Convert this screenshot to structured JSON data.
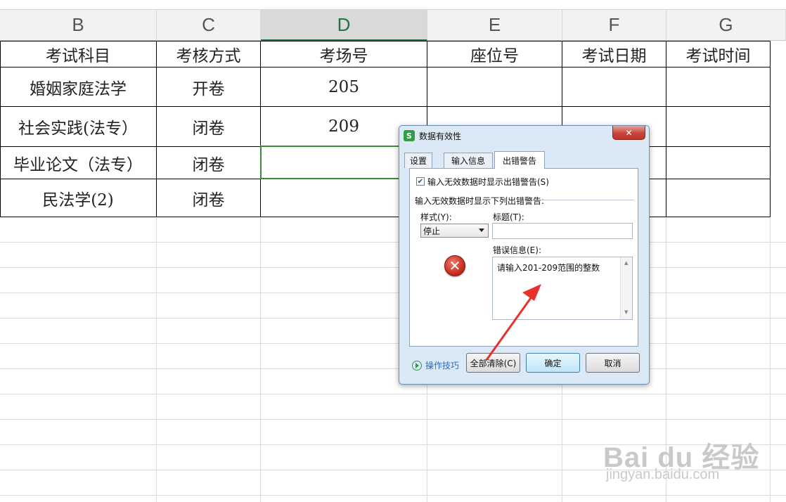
{
  "spreadsheet": {
    "columns": [
      "B",
      "C",
      "D",
      "E",
      "F",
      "G"
    ],
    "active_column": "D",
    "header_row": [
      "考试科目",
      "考核方式",
      "考场号",
      "座位号",
      "考试日期",
      "考试时间"
    ],
    "rows": [
      [
        "婚姻家庭法学",
        "开卷",
        "205",
        "",
        "",
        ""
      ],
      [
        "社会实践(法专）",
        "闭卷",
        "209",
        "",
        "",
        ""
      ],
      [
        "毕业论文（法专）",
        "闭卷",
        "",
        "",
        "",
        ""
      ],
      [
        "民法学(2)",
        "闭卷",
        "",
        "",
        "",
        ""
      ]
    ]
  },
  "dialog": {
    "title": "数据有效性",
    "close_label": "✕",
    "tabs": [
      "设置",
      "输入信息",
      "出错警告"
    ],
    "active_tab": "出错警告",
    "show_error_checkbox": {
      "checked": true,
      "label": "输入无效数据时显示出错警告(S)"
    },
    "section_label": "输入无效数据时显示下列出错警告:",
    "style_label": "样式(Y):",
    "style_value": "停止",
    "title_label": "标题(T):",
    "title_value": "",
    "error_message_label": "错误信息(E):",
    "error_message_value": "请输入201-209范围的整数",
    "tips_label": "操作技巧",
    "clear_all_label": "全部清除(C)",
    "ok_label": "确定",
    "cancel_label": "取消"
  },
  "annotation": {
    "arrow_color": "#e8312a"
  },
  "watermark": {
    "brand": "Bai du 经验",
    "url": "jingyan.baidu.com"
  }
}
